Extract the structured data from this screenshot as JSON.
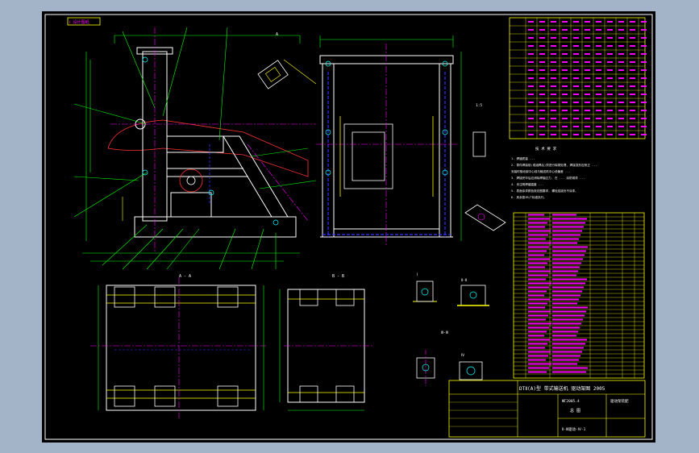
{
  "drawing": {
    "corner_tag": "Ⅰ 设计图纸",
    "title_block_title": "DTⅡ(A)型 带式输送机 驱动架图 2005",
    "title_block_part": "ЖГ2005.4",
    "title_block_sub": "驱动架装配",
    "title_block_name": "总 图",
    "drawing_number": "Ⅱ-Ⅲ驱动-Ⅳ-1"
  },
  "views": {
    "front": {
      "label": "A"
    },
    "section_a": {
      "label": "A - A"
    },
    "section_b": {
      "label": "B - B"
    },
    "detail_1": {
      "label": "Ⅰ",
      "scale": "1:5"
    },
    "detail_2": {
      "label": "Ⅱ-Ⅱ",
      "scale": "1:5"
    },
    "detail_3": {
      "label": "Ⅲ-Ⅲ",
      "scale": "1:5"
    },
    "detail_4": {
      "label": "Ⅳ",
      "scale": "1:5"
    }
  },
  "notes": {
    "heading": "技 术 要 求",
    "lines": [
      "1. 焊缝质量 ...",
      "2. 零件焊接前(或组焊后)须进行除锈处理, 焊接变形应矫正 ...",
      "   安装时驱动架中心线与输送机中心线偏差 ...",
      "3. 焊接完毕后应消除焊接应力, 在 ... 涂防锈漆 ...",
      "4. 未注明焊缝高度 ...",
      "5. 表面涂漆颜色按总图要求, 螺栓连接处不涂漆。",
      "6. 其余按JB/T标准执行。"
    ]
  },
  "colors": {
    "outline": "#ffffff",
    "dimension": "#00ff00",
    "center": "#ff00ff",
    "hidden": "#3333ff",
    "section": "#ffff00",
    "leader": "#00ffff",
    "accent": "#ff3333"
  }
}
